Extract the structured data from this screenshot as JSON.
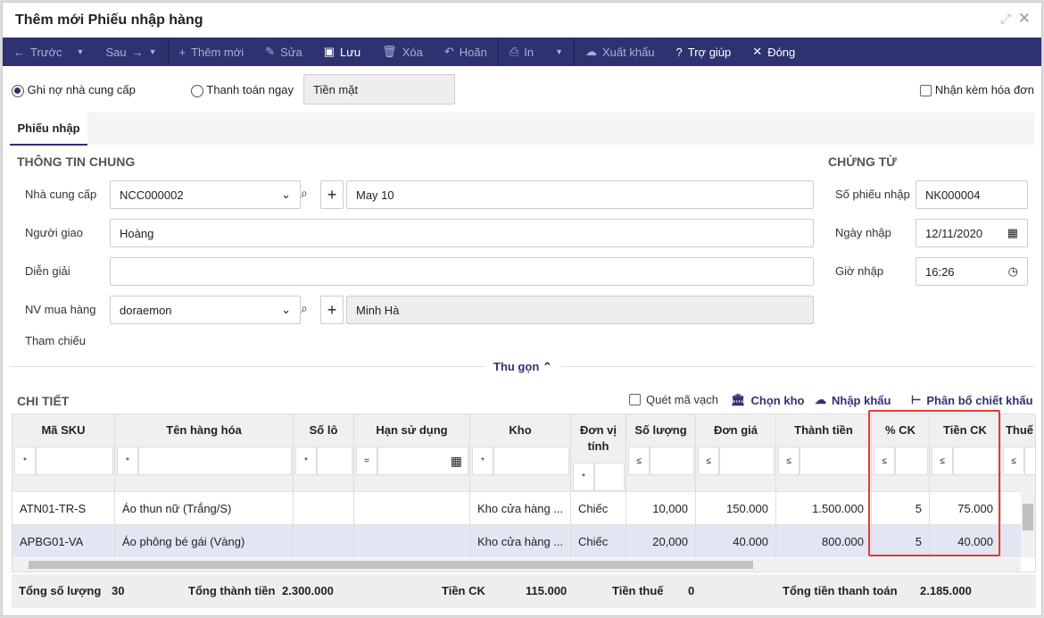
{
  "window": {
    "title": "Thêm mới Phiếu nhập hàng"
  },
  "toolbar": {
    "prev": "Trước",
    "next": "Sau",
    "add": "Thêm mới",
    "edit": "Sửa",
    "save": "Lưu",
    "delete": "Xóa",
    "undo": "Hoãn",
    "print": "In",
    "export": "Xuất khẩu",
    "help": "Trợ giúp",
    "close": "Đóng"
  },
  "payment": {
    "debt": "Ghi nợ nhà cung cấp",
    "pay_now": "Thanh toán ngay",
    "method": "Tiền mặt",
    "invoice": "Nhận kèm hóa đơn",
    "selected": "debt"
  },
  "tab": "Phiếu nhập",
  "general": {
    "title": "THÔNG TIN CHUNG",
    "supplier_label": "Nhà cung cấp",
    "supplier_code": "NCC000002",
    "supplier_name": "May 10",
    "deliverer_label": "Người giao",
    "deliverer": "Hoàng",
    "desc_label": "Diễn giải",
    "desc": "",
    "buyer_label": "NV mua hàng",
    "buyer_code": "doraemon",
    "buyer_name": "Minh Hà",
    "ref_label": "Tham chiếu"
  },
  "voucher": {
    "title": "CHỨNG TỪ",
    "no_label": "Số phiếu nhập",
    "no": "NK000004",
    "date_label": "Ngày nhập",
    "date": "12/11/2020",
    "time_label": "Giờ nhập",
    "time": "16:26"
  },
  "collapse": "Thu gọn",
  "detail": {
    "title": "CHI TIẾT",
    "scan": "Quét mã vạch",
    "choose_wh": "Chọn kho",
    "import": "Nhập khẩu",
    "allocate": "Phân bổ chiết khấu"
  },
  "columns": [
    "Mã SKU",
    "Tên hàng hóa",
    "Số lô",
    "Hạn sử dụng",
    "Kho",
    "Đơn vị tính",
    "Số lượng",
    "Đơn giá",
    "Thành tiền",
    "% CK",
    "Tiền CK",
    "Thuế"
  ],
  "filters": [
    "*",
    "*",
    "*",
    "=",
    "*",
    "*",
    "≤",
    "≤",
    "≤",
    "≤",
    "≤",
    "≤"
  ],
  "rows": [
    [
      "ATN01-TR-S",
      "Áo thun nữ (Trắng/S)",
      "",
      "",
      "Kho cửa hàng ...",
      "Chiếc",
      "10,000",
      "150.000",
      "1.500.000",
      "5",
      "75.000",
      ""
    ],
    [
      "APBG01-VA",
      "Áo phông bé gái (Vàng)",
      "",
      "",
      "Kho cửa hàng ...",
      "Chiếc",
      "20,000",
      "40.000",
      "800.000",
      "5",
      "40.000",
      ""
    ]
  ],
  "footer": {
    "qty_label": "Tổng số lượng",
    "qty": "30",
    "total_label": "Tổng thành tiền",
    "total": "2.300.000",
    "disc_label": "Tiền CK",
    "disc": "115.000",
    "tax_label": "Tiền thuế",
    "tax": "0",
    "pay_label": "Tổng tiền thanh toán",
    "pay": "2.185.000"
  },
  "colors": {
    "toolbar": "#2d3270",
    "highlight": "#e53935",
    "selected_row": "#e3e5f3"
  }
}
